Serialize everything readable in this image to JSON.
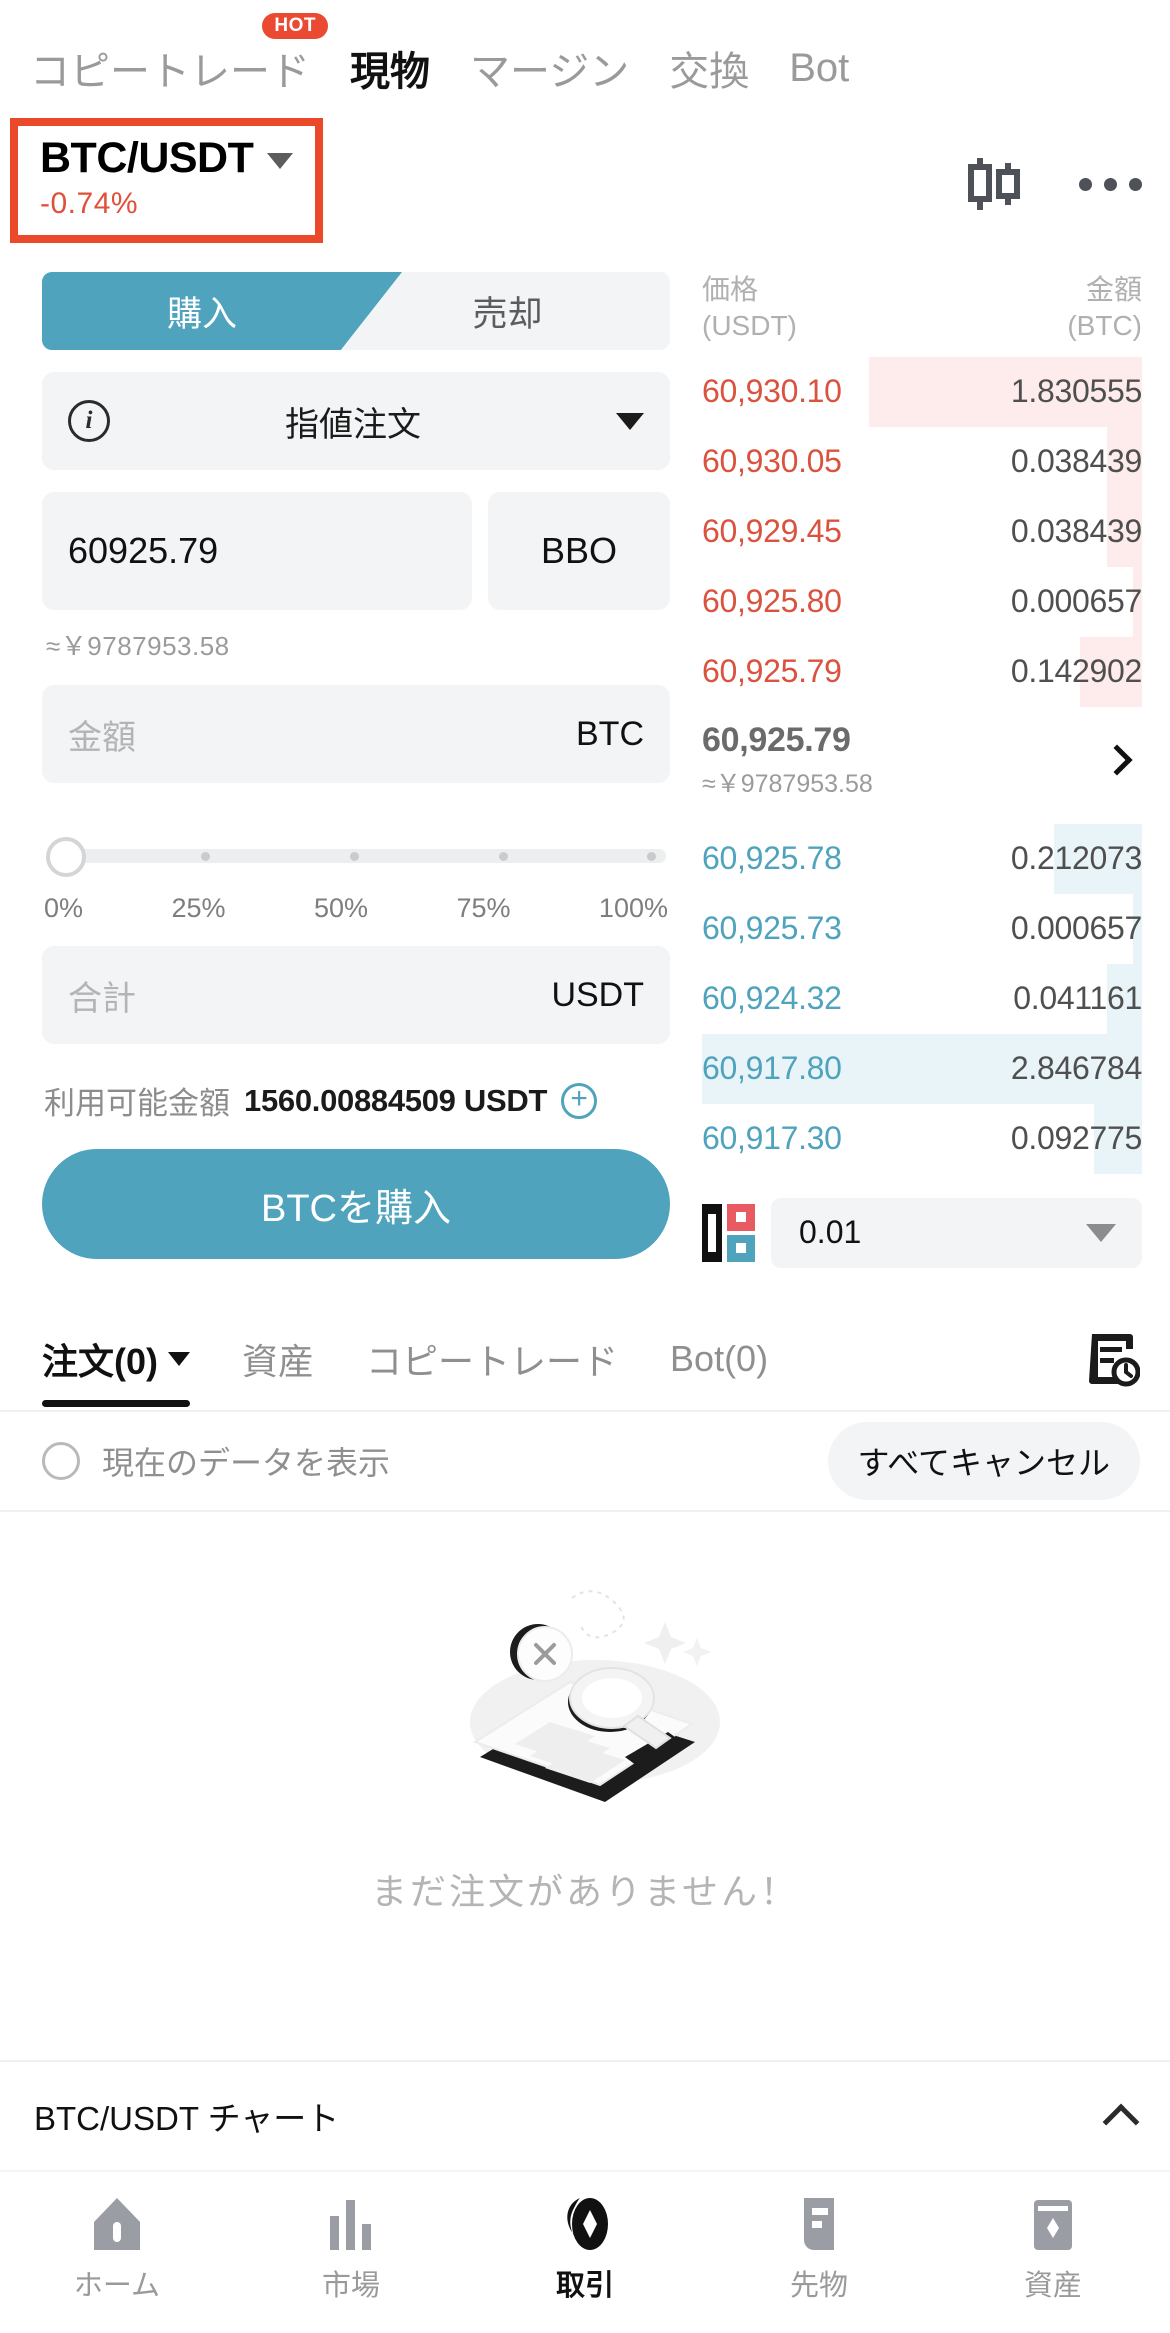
{
  "topnav": {
    "items": [
      {
        "label": "コピートレード",
        "badge": "HOT",
        "active": false
      },
      {
        "label": "現物",
        "active": true
      },
      {
        "label": "マージン",
        "active": false
      },
      {
        "label": "交換",
        "active": false
      },
      {
        "label": "Bot",
        "active": false
      }
    ]
  },
  "symbol": {
    "pair": "BTC/USDT",
    "change": "-0.74%",
    "change_color": "#e0503a",
    "highlight_color": "#ea4a2a",
    "chart_icon": "candlestick-icon",
    "more_icon": "more-horizontal-icon"
  },
  "trade": {
    "buy_tab": "購入",
    "sell_tab": "売却",
    "order_type": "指値注文",
    "info_icon": "info-icon",
    "price_value": "60925.79",
    "bbo_label": "BBO",
    "price_approx": "≈￥9787953.58",
    "amount_placeholder": "金額",
    "amount_unit": "BTC",
    "slider_value": 0,
    "slider_labels": [
      "0%",
      "25%",
      "50%",
      "75%",
      "100%"
    ],
    "total_placeholder": "合計",
    "total_unit": "USDT",
    "available_label": "利用可能金額",
    "available_value": "1560.00884509 USDT",
    "add_funds_icon": "plus-circle-icon",
    "submit_label": "BTCを購入",
    "accent_color": "#4fa3bd"
  },
  "orderbook": {
    "header": {
      "price_label": "価格",
      "price_unit": "(USDT)",
      "amount_label": "金額",
      "amount_unit": "(BTC)"
    },
    "asks": [
      {
        "price": "60,930.10",
        "amount": "1.830555",
        "bar_pct": 62
      },
      {
        "price": "60,930.05",
        "amount": "0.038439",
        "bar_pct": 8
      },
      {
        "price": "60,929.45",
        "amount": "0.038439",
        "bar_pct": 8
      },
      {
        "price": "60,925.80",
        "amount": "0.000657",
        "bar_pct": 2
      },
      {
        "price": "60,925.79",
        "amount": "0.142902",
        "bar_pct": 14
      }
    ],
    "mid": {
      "price": "60,925.79",
      "approx": "≈￥9787953.58",
      "chevron_icon": "chevron-right-icon"
    },
    "bids": [
      {
        "price": "60,925.78",
        "amount": "0.212073",
        "bar_pct": 20
      },
      {
        "price": "60,925.73",
        "amount": "0.000657",
        "bar_pct": 2
      },
      {
        "price": "60,924.32",
        "amount": "0.041161",
        "bar_pct": 8
      },
      {
        "price": "60,917.80",
        "amount": "2.846784",
        "bar_pct": 100
      },
      {
        "price": "60,917.30",
        "amount": "0.092775",
        "bar_pct": 11
      }
    ],
    "ask_color": "#d9533f",
    "bid_color": "#4fa3bd",
    "layout_icon": "orderbook-layout-icon",
    "depth_value": "0.01"
  },
  "orders": {
    "tabs": [
      {
        "label": "注文(0)",
        "active": true,
        "has_caret": true
      },
      {
        "label": "資産",
        "active": false
      },
      {
        "label": "コピートレード",
        "active": false
      },
      {
        "label": "Bot(0)",
        "active": false
      }
    ],
    "history_icon": "order-history-icon",
    "filter_label": "現在のデータを表示",
    "filter_radio_icon": "radio-unchecked-icon",
    "cancel_all_label": "すべてキャンセル",
    "empty_text": "まだ注文がありません！",
    "empty_illustration": "empty-document-search-illustration"
  },
  "chartbar": {
    "label": "BTC/USDT チャート",
    "toggle_icon": "chevron-up-icon"
  },
  "bottomnav": {
    "items": [
      {
        "label": "ホーム",
        "icon": "home-icon",
        "active": false
      },
      {
        "label": "市場",
        "icon": "market-bars-icon",
        "active": false
      },
      {
        "label": "取引",
        "icon": "trade-icon",
        "active": true
      },
      {
        "label": "先物",
        "icon": "futures-icon",
        "active": false
      },
      {
        "label": "資産",
        "icon": "assets-wallet-icon",
        "active": false
      }
    ]
  }
}
